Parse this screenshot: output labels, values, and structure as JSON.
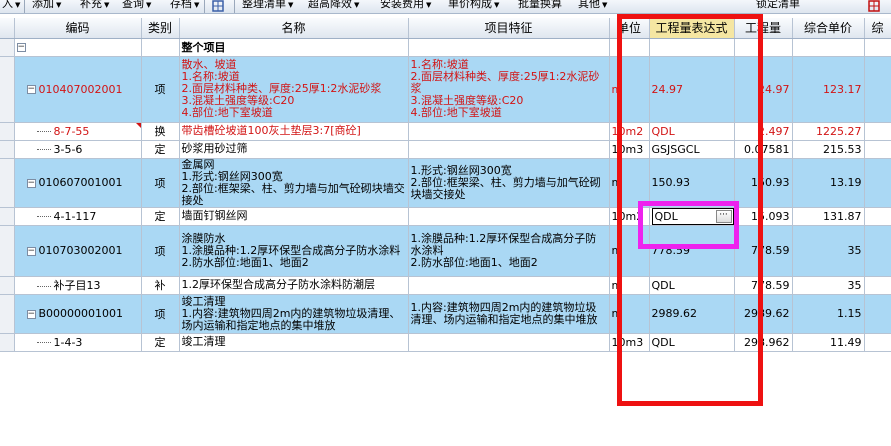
{
  "toolbar": {
    "items": [
      {
        "label": "入",
        "arrow": true
      },
      {
        "label": "添加",
        "arrow": true
      },
      {
        "label": "补充",
        "arrow": true
      },
      {
        "label": "查询",
        "arrow": true
      },
      {
        "label": "存档",
        "arrow": true
      },
      {
        "label": "整理清单",
        "arrow": true
      },
      {
        "label": "超高降效",
        "arrow": true
      },
      {
        "label": "安装费用",
        "arrow": true
      },
      {
        "label": "单价构成",
        "arrow": true
      },
      {
        "label": "批量换算",
        "arrow": false
      },
      {
        "label": "其他",
        "arrow": true
      },
      {
        "label": "锁定清单",
        "arrow": false
      }
    ]
  },
  "columns": {
    "code": "编码",
    "type": "类别",
    "name": "名称",
    "feature": "项目特征",
    "unit": "单位",
    "expr": "工程量表达式",
    "qty": "工程量",
    "price": "综合单价",
    "extra": "综"
  },
  "rows": [
    {
      "kind": "root",
      "code": "",
      "type": "",
      "name": "整个项目",
      "feature": "",
      "unit": "",
      "expr": "",
      "qty": "",
      "price": ""
    },
    {
      "kind": "item",
      "code": "010407002001",
      "type": "项",
      "name": "散水、坡道\n1.名称:坡道\n2.面层材料种类、厚度:25厚1:2水泥砂浆\n3.混凝土强度等级:C20\n4.部位:地下室坡道",
      "feature": "1.名称:坡道\n2.面层材料种类、厚度:25厚1:2水泥砂浆\n3.混凝土强度等级:C20\n4.部位:地下室坡道",
      "unit": "m",
      "expr": "24.97",
      "qty": "24.97",
      "price": "123.17"
    },
    {
      "kind": "sub",
      "code": "8-7-55",
      "type": "换",
      "name": "带齿槽砼坡道100灰土垫层3:7[商砼]",
      "feature": "",
      "unit": "10m2",
      "expr": "QDL",
      "qty": "2.497",
      "price": "1225.27",
      "red": true
    },
    {
      "kind": "sub",
      "code": "3-5-6",
      "type": "定",
      "name": "砂浆用砂过筛",
      "feature": "",
      "unit": "10m3",
      "expr": "GSJSGCL",
      "qty": "0.07581",
      "price": "215.53"
    },
    {
      "kind": "item",
      "code": "010607001001",
      "type": "项",
      "name": "金属网\n1.形式:钢丝网300宽\n2.部位:框架梁、柱、剪力墙与加气砼砌块墙交接处",
      "feature": "1.形式:钢丝网300宽\n2.部位:框架梁、柱、剪力墙与加气砼砌块墙交接处",
      "unit": "m",
      "expr": "150.93",
      "qty": "150.93",
      "price": "13.19"
    },
    {
      "kind": "sub",
      "code": "4-1-117",
      "type": "定",
      "name": "墙面钉钢丝网",
      "feature": "",
      "unit": "10m2",
      "expr": "QDL",
      "qty": "15.093",
      "price": "131.87",
      "current": true
    },
    {
      "kind": "item",
      "code": "010703002001",
      "type": "项",
      "name": "涂膜防水\n1.涂膜品种:1.2厚环保型合成高分子防水涂料\n2.防水部位:地面1、地面2",
      "feature": "1.涂膜品种:1.2厚环保型合成高分子防水涂料\n2.防水部位:地面1、地面2",
      "unit": "m",
      "expr": "778.59",
      "qty": "778.59",
      "price": "35"
    },
    {
      "kind": "sub",
      "code": "补子目13",
      "type": "补",
      "name": "1.2厚环保型合成高分子防水涂料防潮层",
      "feature": "",
      "unit": "m",
      "expr": "QDL",
      "qty": "778.59",
      "price": "35"
    },
    {
      "kind": "item",
      "code": "B00000001001",
      "type": "项",
      "name": "竣工清理\n1.内容:建筑物四周2m内的建筑物垃圾清理、场内运输和指定地点的集中堆放",
      "feature": "1.内容:建筑物四周2m内的建筑物垃圾清理、场内运输和指定地点的集中堆放",
      "unit": "m",
      "expr": "2989.62",
      "qty": "2989.62",
      "price": "1.15"
    },
    {
      "kind": "sub",
      "code": "1-4-3",
      "type": "定",
      "name": "竣工清理",
      "feature": "",
      "unit": "10m3",
      "expr": "QDL",
      "qty": "298.962",
      "price": "11.49"
    }
  ],
  "editor": {
    "value": "QDL",
    "button": "···"
  },
  "colors": {
    "item_row": "#aad8f4",
    "highlight_text": "#d21414",
    "red_box": "#ee1111",
    "magenta_box": "#ee22ee",
    "expr_header": "#f5e6a2"
  }
}
